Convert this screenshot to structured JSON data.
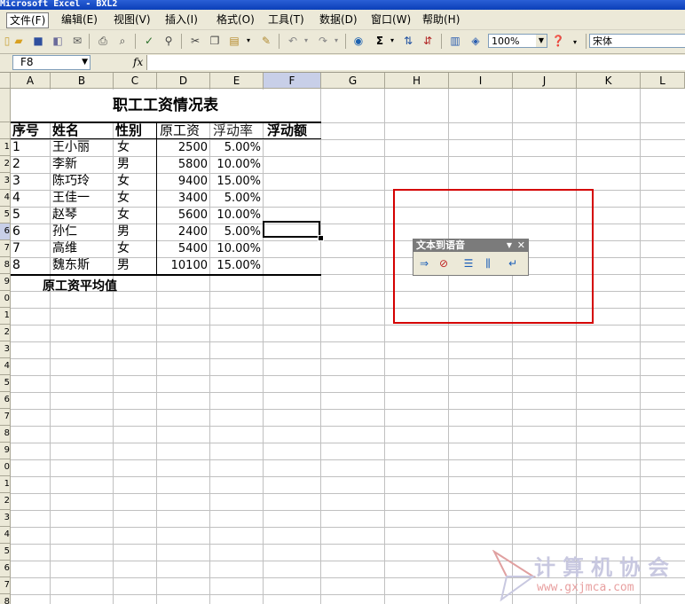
{
  "window": {
    "title": "Microsoft Excel - BXL2"
  },
  "menu": [
    "文件(F)",
    "编辑(E)",
    "视图(V)",
    "插入(I)",
    "格式(O)",
    "工具(T)",
    "数据(D)",
    "窗口(W)",
    "帮助(H)"
  ],
  "toolbar": {
    "zoom": "100%",
    "font": "宋体",
    "sigma": "Σ"
  },
  "formula_bar": {
    "name_box": "F8",
    "fx": "fx",
    "content": ""
  },
  "columns": [
    "A",
    "B",
    "C",
    "D",
    "E",
    "F",
    "G",
    "H",
    "I",
    "J",
    "K",
    "L"
  ],
  "rows": [
    "",
    "",
    "1",
    "2",
    "3",
    "4",
    "5",
    "6",
    "7",
    "8",
    "9",
    "0",
    "1",
    "2",
    "3",
    "4",
    "5",
    "6",
    "7",
    "8",
    "9",
    "0",
    "1",
    "2",
    "3",
    "4",
    "5",
    "6",
    "7",
    "8",
    "9",
    "0"
  ],
  "sheet": {
    "title": "职工工资情况表",
    "headers": [
      "序号",
      "姓名",
      "性别",
      "原工资",
      "浮动率",
      "浮动额"
    ],
    "records": [
      {
        "no": "1",
        "name": "王小丽",
        "sex": "女",
        "salary": "2500",
        "rate": "5.00%"
      },
      {
        "no": "2",
        "name": "李新",
        "sex": "男",
        "salary": "5800",
        "rate": "10.00%"
      },
      {
        "no": "3",
        "name": "陈巧玲",
        "sex": "女",
        "salary": "9400",
        "rate": "15.00%"
      },
      {
        "no": "4",
        "name": "王佳一",
        "sex": "女",
        "salary": "3400",
        "rate": "5.00%"
      },
      {
        "no": "5",
        "name": "赵琴",
        "sex": "女",
        "salary": "5600",
        "rate": "10.00%"
      },
      {
        "no": "6",
        "name": "孙仁",
        "sex": "男",
        "salary": "2400",
        "rate": "5.00%"
      },
      {
        "no": "7",
        "name": "高维",
        "sex": "女",
        "salary": "5400",
        "rate": "10.00%"
      },
      {
        "no": "8",
        "name": "魏东斯",
        "sex": "男",
        "salary": "10100",
        "rate": "15.00%"
      }
    ],
    "average_label": "原工资平均值"
  },
  "text_to_speech": {
    "title": "文本到语音"
  },
  "watermark": {
    "title": "计算机协会",
    "url": "www.gxjmca.com"
  }
}
